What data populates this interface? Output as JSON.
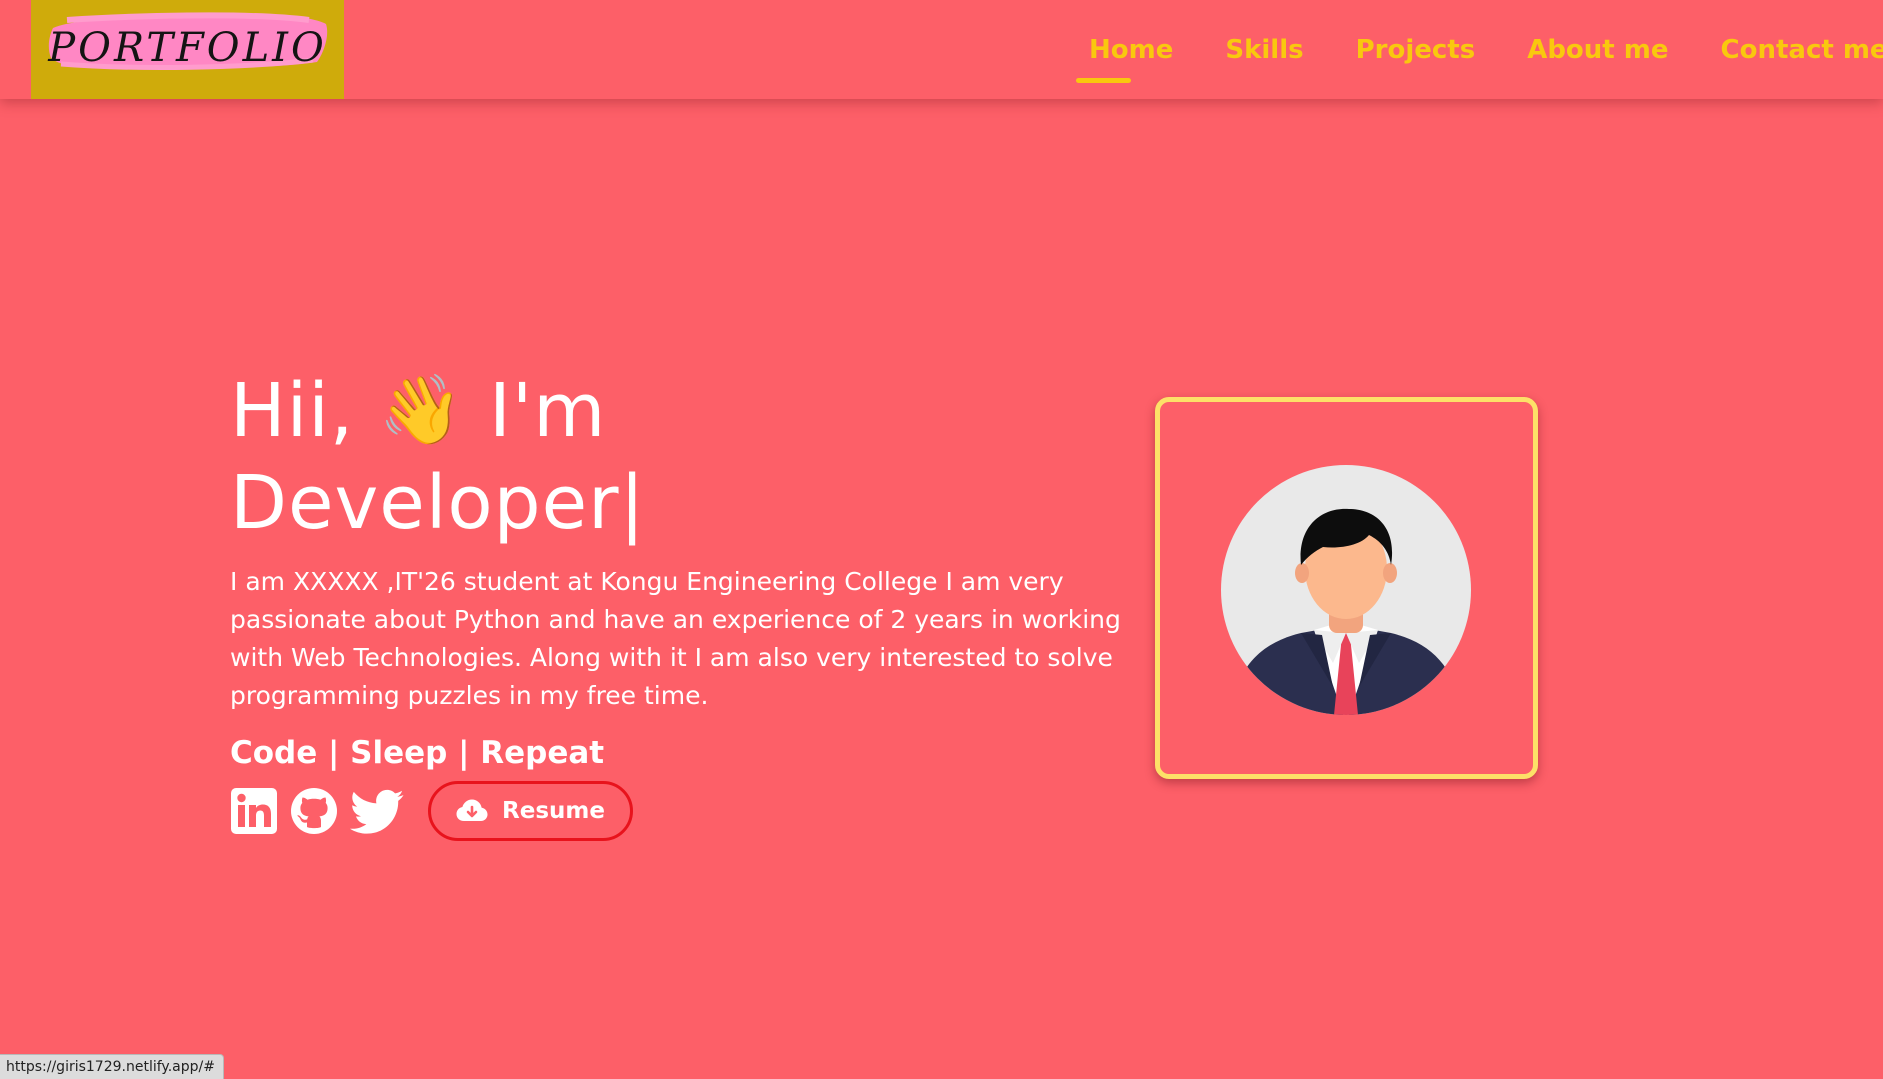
{
  "logo": {
    "text": "PORTFOLIO"
  },
  "nav": {
    "items": [
      {
        "label": "Home",
        "active": true
      },
      {
        "label": "Skills",
        "active": false
      },
      {
        "label": "Projects",
        "active": false
      },
      {
        "label": "About me",
        "active": false
      },
      {
        "label": "Contact me",
        "active": false
      }
    ]
  },
  "hero": {
    "greeting": "Hii,",
    "wave_emoji": "👋",
    "intro": "I'm",
    "role": "Developer|",
    "description": "I am XXXXX ,IT'26 student at Kongu Engineering College I am very passionate about Python and have an experience of 2 years in working with Web Technologies. Along with it I am also very interested to solve programming puzzles in my free time.",
    "tagline": "Code | Sleep | Repeat",
    "social": [
      "linkedin-icon",
      "github-icon",
      "twitter-icon"
    ],
    "resume_label": "Resume"
  },
  "status_bar": {
    "url": "https://giris1729.netlify.app/#"
  },
  "colors": {
    "background": "#fd5f68",
    "accent": "#f9c80e",
    "logo_bg": "#cfab0b",
    "logo_highlight": "#ff87c4",
    "card_border": "#fde068",
    "resume_border": "#e8131c"
  }
}
